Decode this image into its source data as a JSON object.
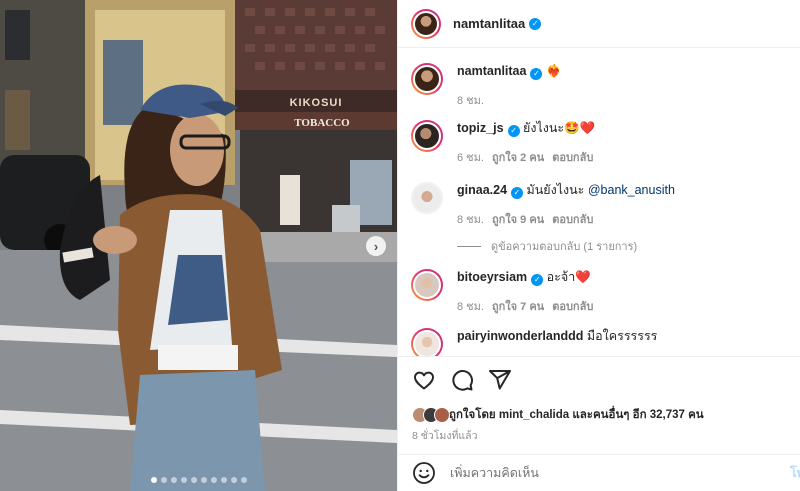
{
  "post": {
    "author": "namtanlitaa",
    "verified": true
  },
  "photo": {
    "sign_kikosui": "KIKOSUI",
    "sign_tobacco": "TOBACCO",
    "slides": 10,
    "active_slide": 1
  },
  "comments": [
    {
      "user": "namtanlitaa",
      "text": "❤️‍🔥",
      "time": "8 ชม.",
      "likes": "",
      "reply": ""
    },
    {
      "user": "topiz_js",
      "text": "ยังไงนะ🤩❤️",
      "time": "6 ชม.",
      "likes": "ถูกใจ 2 คน",
      "reply": "ตอบกลับ"
    },
    {
      "user": "ginaa.24",
      "text": "มันยังไงนะ ",
      "mention": "@bank_anusith",
      "time": "8 ชม.",
      "likes": "ถูกใจ 9 คน",
      "reply": "ตอบกลับ"
    },
    {
      "user": "bitoeyrsiam",
      "text": "อะจ้า❤️",
      "time": "8 ชม.",
      "likes": "ถูกใจ 7 คน",
      "reply": "ตอบกลับ"
    },
    {
      "user": "pairyinwonderlanddd",
      "text": "มือใครรรรรร",
      "time": "",
      "likes": "",
      "reply": ""
    }
  ],
  "view_replies": "ดูข้อความตอบกลับ (1 รายการ)",
  "likes_summary": "ถูกใจโดย mint_chalida และคนอื่นๆ อีก 32,737 คน",
  "post_time": "8 ชั่วโมงที่แล้ว",
  "add_comment_placeholder": "เพิ่มความคิดเห็น",
  "post_button": "โพ",
  "icons": [
    "heart-icon",
    "comment-icon",
    "share-icon",
    "emoji-icon",
    "verified-icon",
    "chevron-right-icon"
  ],
  "colors": {
    "verified": "#0095f6",
    "mention": "#00376b",
    "meta": "#8e8e8e",
    "post_btn": "#b3dbff"
  }
}
